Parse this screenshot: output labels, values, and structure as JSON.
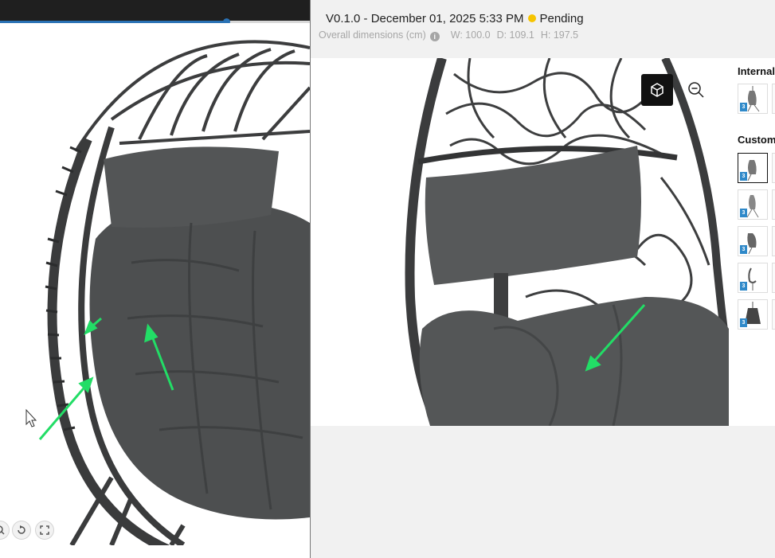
{
  "colors": {
    "accent": "#2a72b5",
    "status_pending": "#f6c400",
    "annotation_arrow": "#22dd66",
    "topbar": "#1f1f1f"
  },
  "left_viewer": {
    "playback_progress": 0.73,
    "controls": [
      "zoom-icon",
      "rotate-icon",
      "fullscreen-icon"
    ]
  },
  "header": {
    "version": "V0.1.0 - December 01, 2025 5:33 PM",
    "status": "Pending",
    "dimensions_label": "Overall dimensions (cm)",
    "info_icon": "i",
    "width": "W: 100.0",
    "depth": "D: 109.1",
    "height": "H: 197.5"
  },
  "toolbar": {
    "cube_icon": "3d-cube-icon",
    "zoom_icon": "zoom-out-icon"
  },
  "side_panel": {
    "internal_heading": "Internal",
    "custom_heading": "Custom",
    "badge": "3"
  }
}
